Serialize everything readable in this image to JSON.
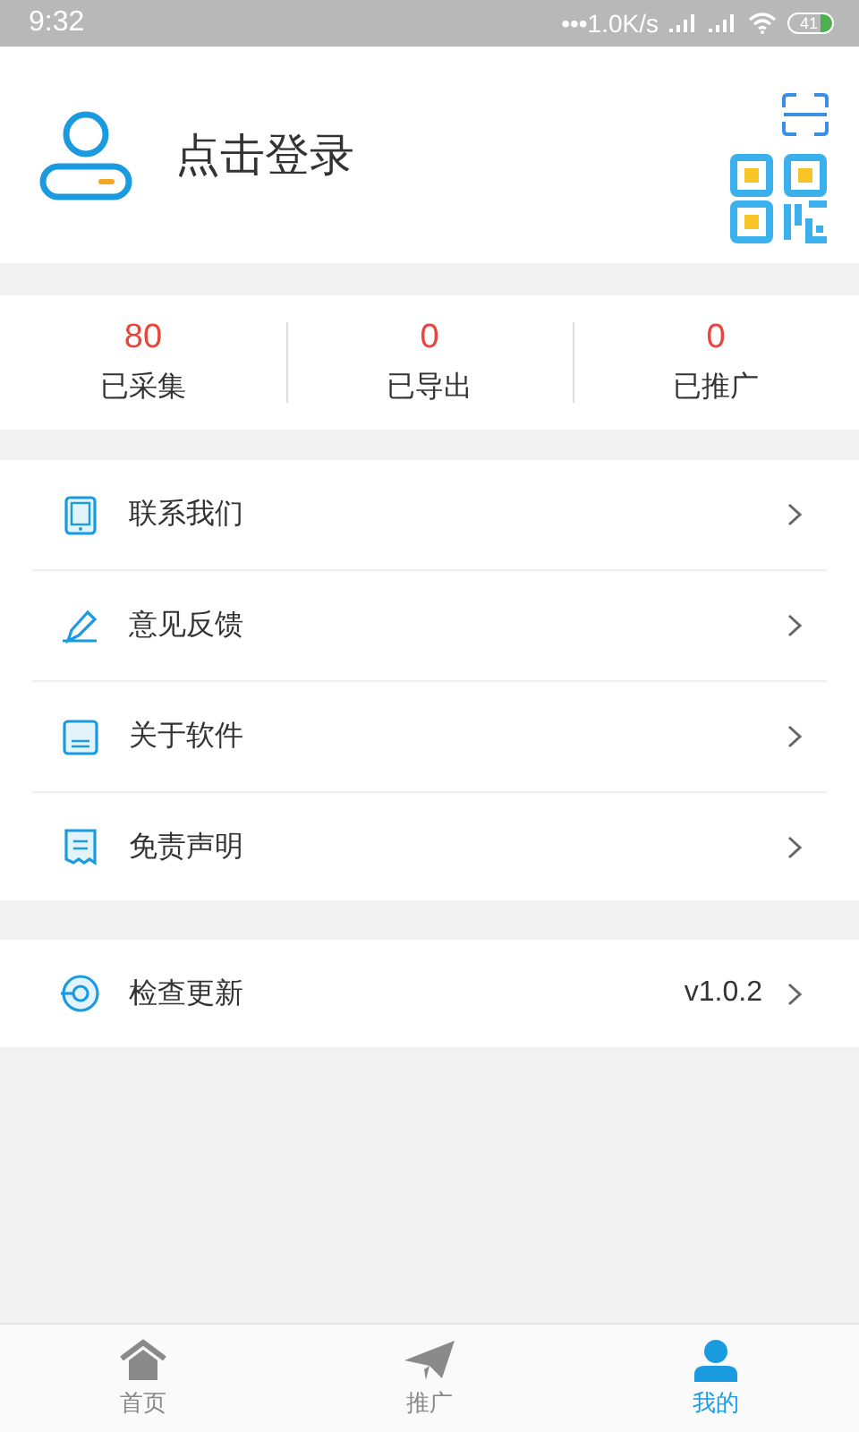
{
  "status_bar": {
    "time": "9:32",
    "speed": "•••1.0K/s",
    "battery": "41"
  },
  "profile": {
    "login_text": "点击登录"
  },
  "stats": [
    {
      "value": "80",
      "label": "已采集"
    },
    {
      "value": "0",
      "label": "已导出"
    },
    {
      "value": "0",
      "label": "已推广"
    }
  ],
  "menu": [
    {
      "kind": "tablet",
      "label": "联系我们"
    },
    {
      "kind": "pen",
      "label": "意见反馈"
    },
    {
      "kind": "book",
      "label": "关于软件"
    },
    {
      "kind": "receipt",
      "label": "免责声明"
    }
  ],
  "update": {
    "kind": "disc",
    "label": "检查更新",
    "version": "v1.0.2"
  },
  "tabs": [
    {
      "kind": "home",
      "label": "首页",
      "selected": false
    },
    {
      "kind": "plane",
      "label": "推广",
      "selected": false
    },
    {
      "kind": "user",
      "label": "我的",
      "selected": true
    }
  ]
}
